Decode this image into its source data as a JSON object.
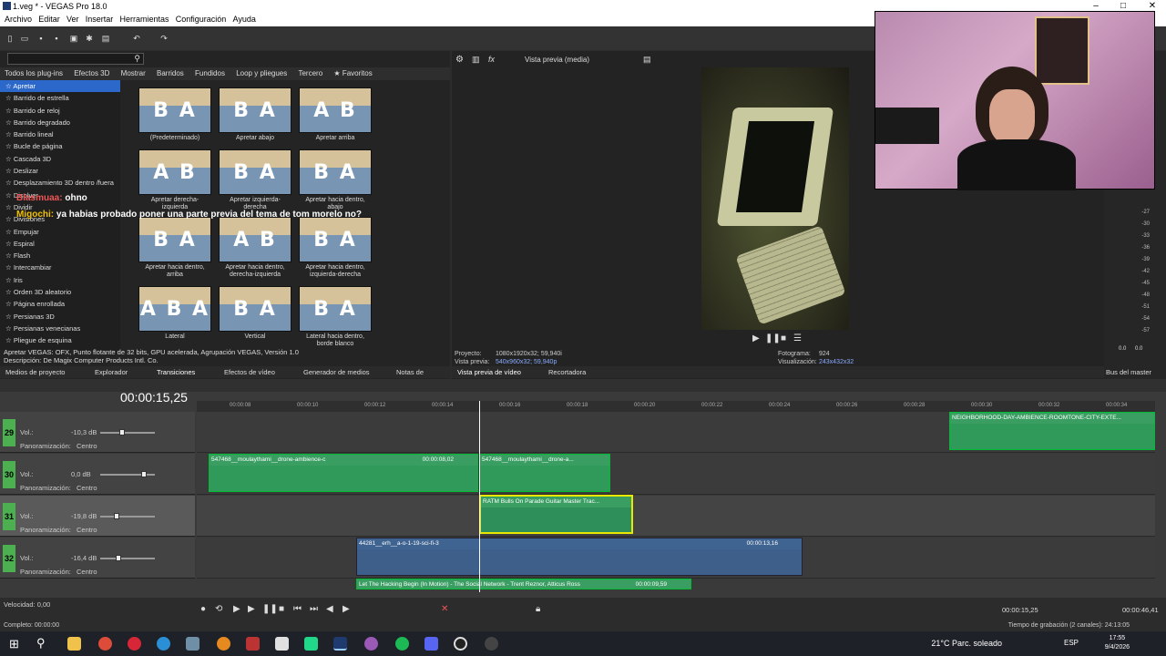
{
  "window": {
    "title": "1.veg * - VEGAS Pro 18.0",
    "controls": [
      "–",
      "□",
      "✕"
    ]
  },
  "menu": [
    "Archivo",
    "Editar",
    "Ver",
    "Insertar",
    "Herramientas",
    "Configuración",
    "Ayuda"
  ],
  "plugin_tabs": [
    "Todos los plug-ins",
    "Efectos 3D",
    "Mostrar",
    "Barridos",
    "Fundidos",
    "Loop y pliegues",
    "Tercero",
    "★ Favoritos"
  ],
  "tree": [
    "Apretar",
    "Barrido de estrella",
    "Barrido de reloj",
    "Barrido degradado",
    "Barrido lineal",
    "Bucle de página",
    "Cascada 3D",
    "Deslizar",
    "Desplazamiento 3D dentro /fuera",
    "Disolver",
    "Dividir",
    "Divisiones",
    "Empujar",
    "Espiral",
    "Flash",
    "Intercambiar",
    "Iris",
    "Orden 3D aleatorio",
    "Página enrollada",
    "Persianas 3D",
    "Persianas venecianas",
    "Pliegue de esquina"
  ],
  "thumbs": [
    {
      "label": "(Predeterminado)",
      "glyph": "B A"
    },
    {
      "label": "Apretar abajo",
      "glyph": "B A"
    },
    {
      "label": "Apretar arriba",
      "glyph": "A B"
    },
    {
      "label": "Apretar derecha-izquierda",
      "glyph": "A B"
    },
    {
      "label": "Apretar izquierda-derecha",
      "glyph": "B A"
    },
    {
      "label": "Apretar hacia dentro, abajo",
      "glyph": "B A"
    },
    {
      "label": "Apretar hacia dentro, arriba",
      "glyph": "B A"
    },
    {
      "label": "Apretar hacia dentro, derecha-izquierda",
      "glyph": "A B"
    },
    {
      "label": "Apretar hacia dentro, izquierda-derecha",
      "glyph": "B A"
    },
    {
      "label": "Lateral",
      "glyph": "A B A"
    },
    {
      "label": "Vertical",
      "glyph": "B A"
    },
    {
      "label": "Lateral hacia dentro, borde blanco",
      "glyph": "B A"
    }
  ],
  "description": {
    "line1": "Apretar VEGAS: OFX, Punto flotante de 32 bits, GPU acelerada, Agrupación VEGAS, Versión 1.0",
    "line2": "Descripción: De Magix Computer Products Intl. Co."
  },
  "bottom_tabs": [
    "Medios de proyecto",
    "Explorador",
    "Transiciones",
    "Efectos de vídeo",
    "Generador de medios",
    "Notas de"
  ],
  "chat": {
    "line1_user": "Blasmuaa:",
    "line1_msg": "ohno",
    "line2_user": "Migochi:",
    "line2_msg": "ya habias probado poner una parte previa del tema de tom morelo no?"
  },
  "preview": {
    "mode": "Vista previa (media)",
    "info": {
      "proyecto_label": "Proyecto:",
      "proyecto": "1080x1920x32; 59,940i",
      "vista_label": "Vista previa:",
      "vista": "540x960x32; 59,940p",
      "fotograma_label": "Fotograma:",
      "fotograma": "924",
      "visual_label": "Visualización:",
      "visual": "243x432x32"
    },
    "tabs": [
      "Vista previa de vídeo",
      "Recortadora"
    ]
  },
  "meter": {
    "ticks": [
      "-27",
      "-30",
      "-33",
      "-36",
      "-39",
      "-42",
      "-45",
      "-48",
      "-51",
      "-54",
      "-57"
    ],
    "bottom": [
      "0.0",
      "0.0"
    ],
    "tab": "Bus del master"
  },
  "timeline": {
    "timecode": "00:00:15,25",
    "ruler": [
      "00:00:08",
      "00:00:10",
      "00:00:12",
      "00:00:14",
      "00:00:16",
      "00:00:18",
      "00:00:20",
      "00:00:22",
      "00:00:24",
      "00:00:26",
      "00:00:28",
      "00:00:30",
      "00:00:32",
      "00:00:34"
    ],
    "tracks": [
      {
        "num": "29",
        "vol": "-10,3 dB",
        "pan": "Centro"
      },
      {
        "num": "30",
        "vol": "0,0 dB",
        "pan": "Centro"
      },
      {
        "num": "31",
        "vol": "-19,8 dB",
        "pan": "Centro"
      },
      {
        "num": "32",
        "vol": "-16,4 dB",
        "pan": "Centro"
      }
    ],
    "vol_label": "Vol.:",
    "pan_label": "Panoramización:",
    "clips": {
      "c1": "NEIGHBORHOOD-DAY-AMBIENCE-ROOMTONE-CITY-EXTE...",
      "c2": "547468__moulaythami__drone-ambience-c",
      "c2_time": "00:00:08,02",
      "c3": "547468__moulaythami__drone-a...",
      "c4": "RATM Bulls On Parade Guitar Master Trac...",
      "c5": "44281__erh__a-o-1-19-sci-fi-3",
      "c5_time": "00:00:13,16",
      "c6": "Let The Hacking Begin (In Motion) - The Social Network - Trent Reznor, Atticus Ross",
      "c6_time": "00:00:09,59"
    },
    "speed": "Velocidad: 0,00",
    "end_time": "00:00:15,25",
    "end_time2": "00:00:46,41"
  },
  "status": {
    "left": "Completo: 00:00:00",
    "right": "Tiempo de grabación (2 canales): 24:13:05"
  },
  "taskbar": {
    "weather": "21°C  Parc. soleado",
    "lang": "ESP",
    "time": "17:55",
    "date": "9/4/2026"
  }
}
